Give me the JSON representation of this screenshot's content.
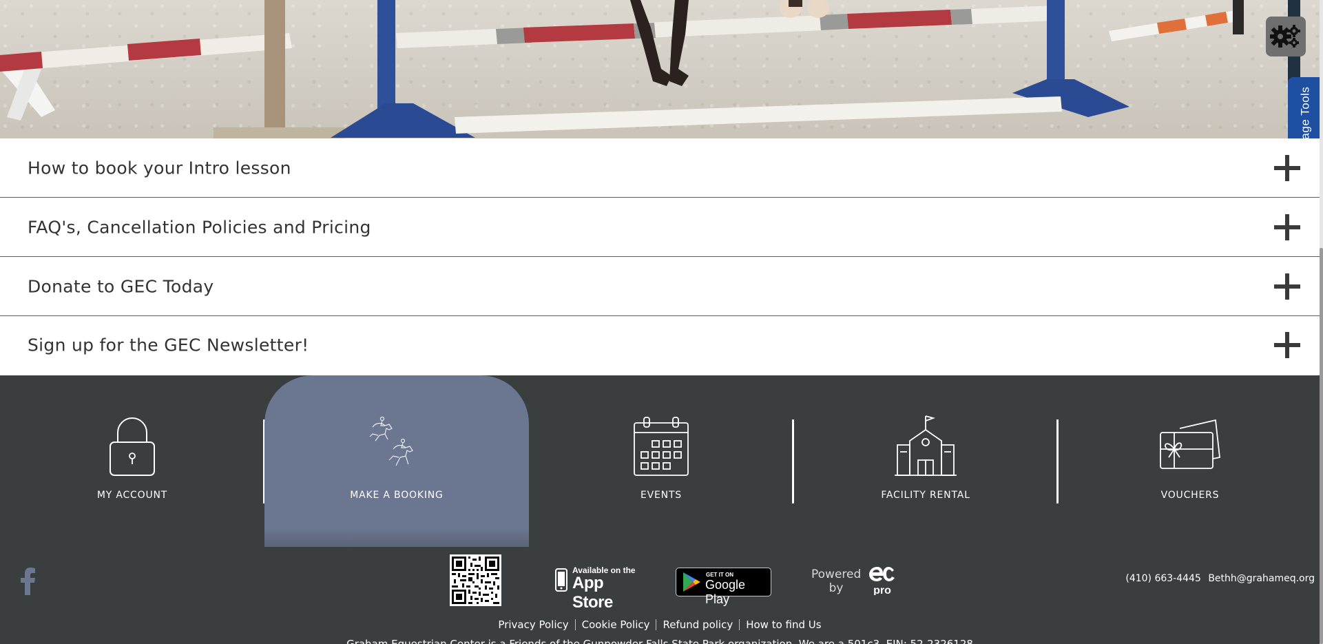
{
  "hero": {
    "alt": "Horse jumping arena with show jump poles"
  },
  "page_tools": {
    "label": "Page Tools"
  },
  "accordion": {
    "items": [
      {
        "title": "How to book your Intro lesson"
      },
      {
        "title": "FAQ's, Cancellation Policies and Pricing"
      },
      {
        "title": "Donate to GEC Today"
      },
      {
        "title": "Sign up for the GEC Newsletter!"
      }
    ]
  },
  "footer_nav": {
    "items": [
      {
        "label": "MY ACCOUNT",
        "icon": "padlock-icon"
      },
      {
        "label": "MAKE A BOOKING",
        "icon": "horse-riders-icon",
        "active": true
      },
      {
        "label": "EVENTS",
        "icon": "calendar-icon"
      },
      {
        "label": "FACILITY RENTAL",
        "icon": "building-icon"
      },
      {
        "label": "VOUCHERS",
        "icon": "gift-voucher-icon"
      }
    ]
  },
  "bottom_bar": {
    "app_store": {
      "small": "Available on the",
      "big": "App Store"
    },
    "google_play": {
      "small": "GET IT ON",
      "big": "Google Play"
    },
    "powered_by": {
      "line1": "Powered",
      "line2": "by"
    },
    "contact": {
      "phone": "(410) 663-4445",
      "email": "Bethh@grahameq.org"
    },
    "links": [
      "Privacy Policy",
      "Cookie Policy",
      "Refund policy",
      "How to find Us"
    ],
    "notice": "Graham Equestrian Center is a Friends of the Gunpowder Falls State Park organization. We are a 501c3. EIN: 52-2326128"
  },
  "colors": {
    "footer_bg": "#3b3e3e",
    "active_nav_bg": "#6b7791",
    "page_tools_bg": "#1e4fa0",
    "facebook_icon": "#6b7791"
  }
}
